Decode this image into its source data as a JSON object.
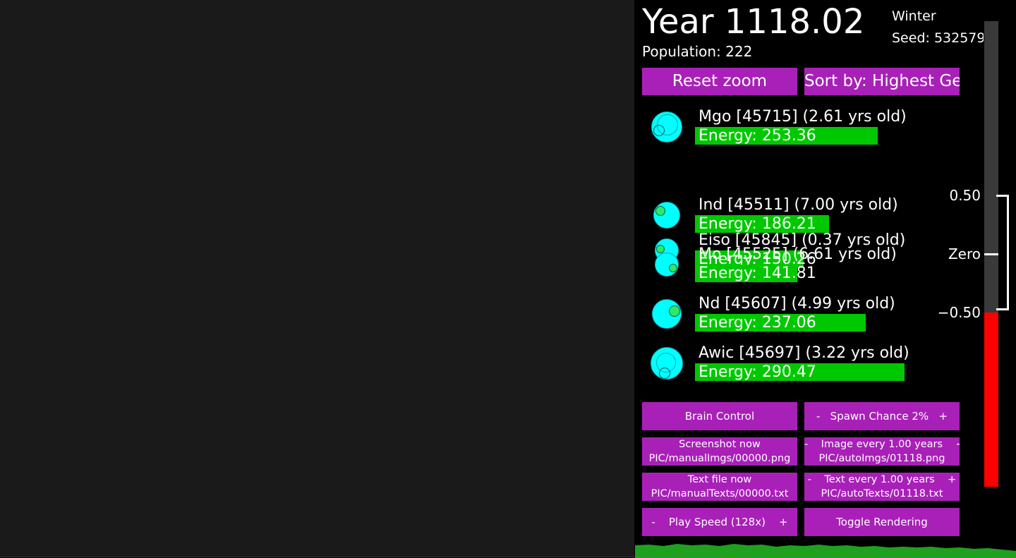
{
  "header": {
    "year": "Year 1118.02",
    "population": "Population: 222",
    "season": "Winter",
    "seed": "Seed: 532579"
  },
  "top_buttons": {
    "reset_zoom": "Reset zoom",
    "sort_by": "Sort by: Highest Gen"
  },
  "creatures": [
    {
      "name": "Mgo [45715] (2.61 yrs old)",
      "energy": "Energy: 253.36",
      "energy_value": 253.36
    },
    {
      "name": "Ind [45511] (7.00 yrs old)",
      "energy": "Energy: 186.21",
      "energy_value": 186.21
    },
    {
      "name": "Eiso [45845] (0.37 yrs old)",
      "energy": "Energy: 150.26",
      "energy_value": 150.26
    },
    {
      "name": "Mo [45525] (6.61 yrs old)",
      "energy": "Energy: 141.81",
      "energy_value": 141.81
    },
    {
      "name": "Nd [45607] (4.99 yrs old)",
      "energy": "Energy: 237.06",
      "energy_value": 237.06
    },
    {
      "name": "Awic [45697] (3.22 yrs old)",
      "energy": "Energy: 290.47",
      "energy_value": 290.47
    }
  ],
  "meter": {
    "label_high": "0.50",
    "label_zero": "Zero",
    "label_low": "−0.50"
  },
  "controls": {
    "brain_control": "Brain Control",
    "spawn_chance": "-   Spawn Chance 2%   +",
    "screenshot_now": "Screenshot now",
    "screenshot_path": "PIC/manualImgs/00000.png",
    "image_every": "-    Image every 1.00 years    +",
    "image_path": "PIC/autoImgs/01118.png",
    "text_file_now": "Text file now",
    "text_file_path": "PIC/manualTexts/00000.txt",
    "text_every": "-    Text every 1.00 years    +",
    "text_path": "PIC/autoTexts/01118.txt",
    "play_speed": "-    Play Speed (128x)    +",
    "toggle_rendering": "Toggle Rendering"
  },
  "colors": {
    "button": "#a820b8",
    "energy_bar": "#00c800",
    "creature_body": "#00ffff",
    "meter_fill": "#ff0000",
    "world_bg": "#1a1a1a"
  }
}
